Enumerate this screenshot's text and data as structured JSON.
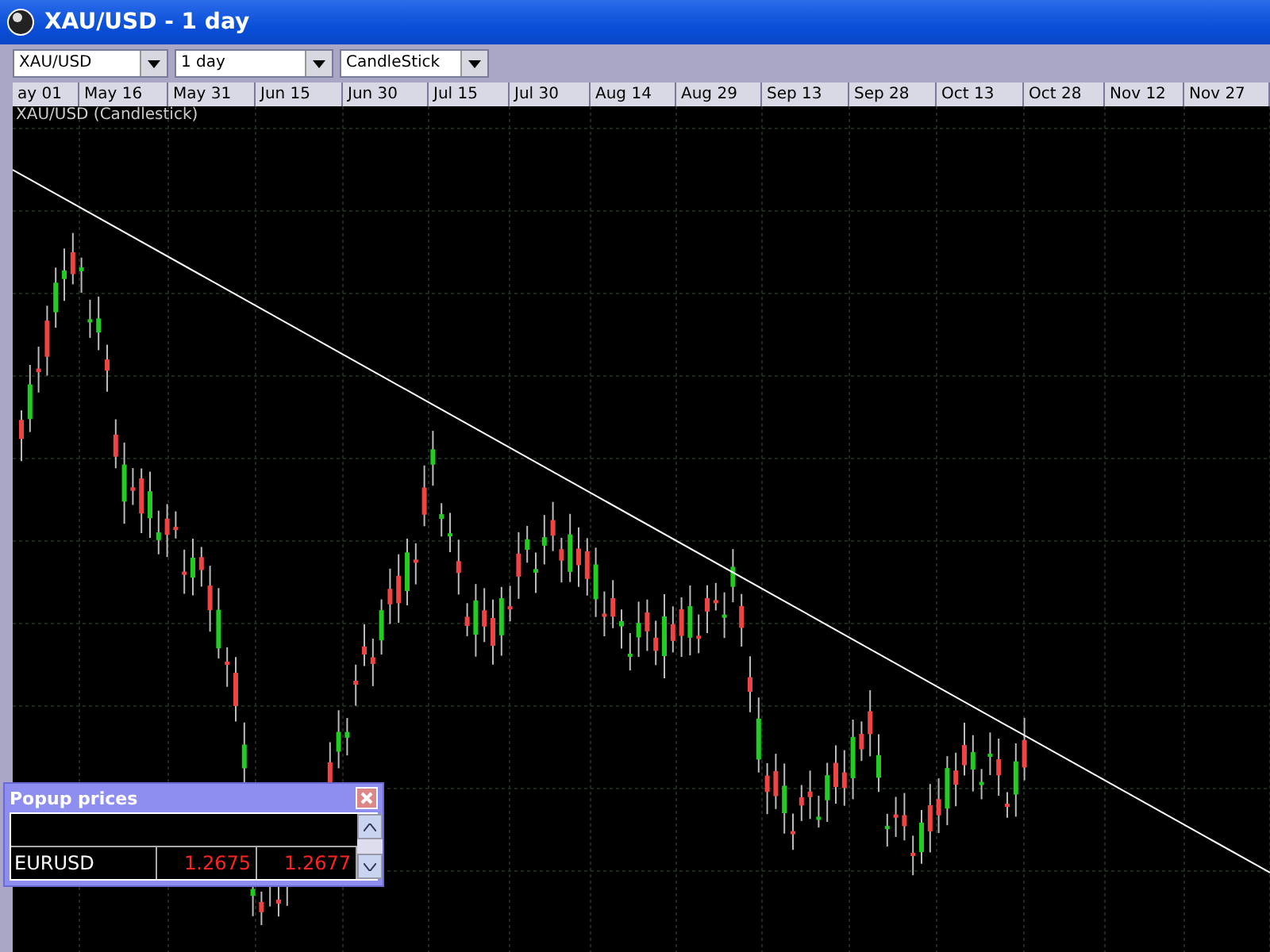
{
  "window": {
    "title": "XAU/USD - 1 day"
  },
  "toolbar": {
    "dropdowns": [
      {
        "value": "XAU/USD"
      },
      {
        "value": "1 day"
      },
      {
        "value": "CandleStick"
      }
    ]
  },
  "date_axis": {
    "labels": [
      "ay 01",
      "May 16",
      "May 31",
      "Jun 15",
      "Jun 30",
      "Jul 15",
      "Jul 30",
      "Aug 14",
      "Aug 29",
      "Sep 13",
      "Sep 28",
      "Oct 13",
      "Oct 28",
      "Nov 12",
      "Nov 27"
    ]
  },
  "chart": {
    "legend": "XAU/USD (Candlestick)"
  },
  "popup": {
    "title": "Popup prices",
    "rows": [
      {
        "symbol": "EURUSD",
        "bid": "1.2675",
        "ask": "1.2677"
      }
    ]
  }
}
